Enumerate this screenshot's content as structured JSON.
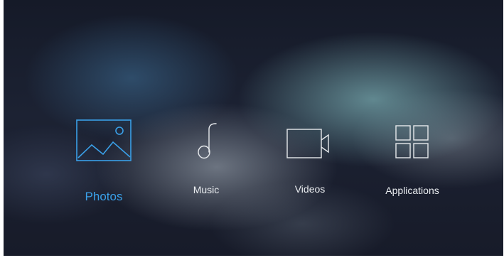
{
  "menu": {
    "items": [
      {
        "label": "Photos",
        "icon": "photo-icon",
        "selected": true
      },
      {
        "label": "Music",
        "icon": "music-note-icon",
        "selected": false
      },
      {
        "label": "Videos",
        "icon": "video-camera-icon",
        "selected": false
      },
      {
        "label": "Applications",
        "icon": "grid-icon",
        "selected": false
      }
    ]
  },
  "colors": {
    "selected": "#3aa0e8",
    "text": "#e9ecef",
    "icon": "#e6e9ec",
    "background": "#1a1f2e"
  }
}
